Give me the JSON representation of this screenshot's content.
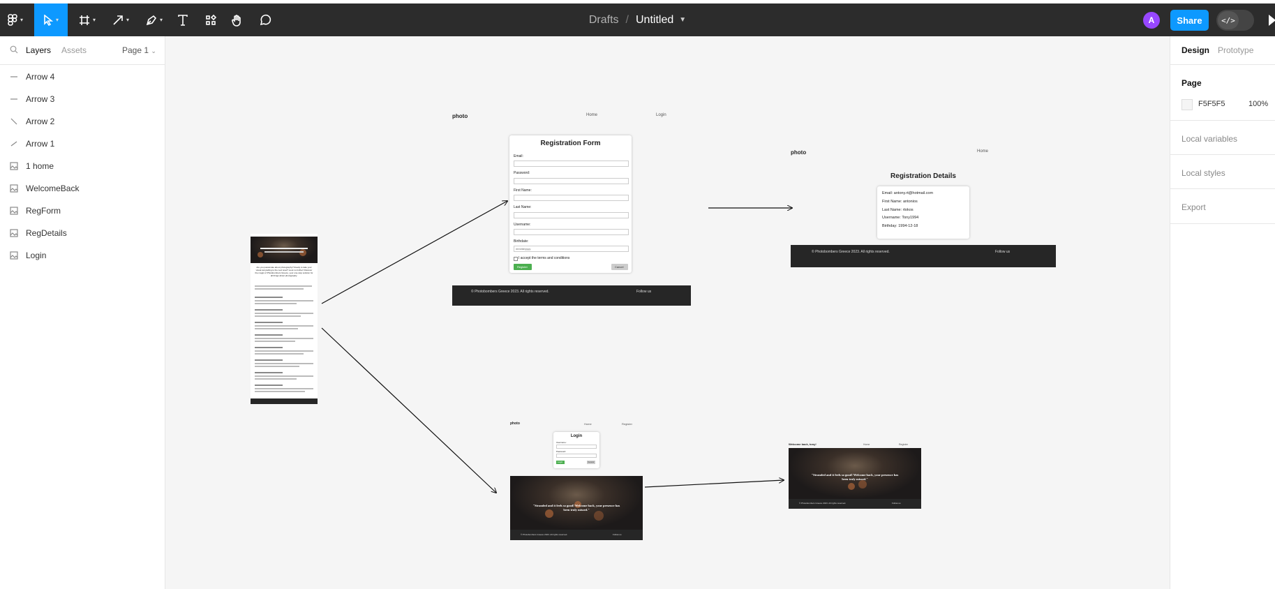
{
  "toolbar": {
    "breadcrumb_drafts": "Drafts",
    "breadcrumb_sep": "/",
    "file_title": "Untitled",
    "avatar_initial": "A",
    "share_label": "Share",
    "dev_mode_icon": "</>",
    "tools": [
      "main-menu",
      "move",
      "frame",
      "shape-arrow",
      "pen",
      "text",
      "resources",
      "hand",
      "comment"
    ]
  },
  "left_panel": {
    "tab_layers": "Layers",
    "tab_assets": "Assets",
    "page_selector": "Page 1",
    "layers": [
      {
        "label": "Arrow 4",
        "icon": "line-horizontal-icon"
      },
      {
        "label": "Arrow 3",
        "icon": "line-horizontal-icon"
      },
      {
        "label": "Arrow 2",
        "icon": "line-diagonal-icon"
      },
      {
        "label": "Arrow 1",
        "icon": "line-slight-icon"
      },
      {
        "label": "1 home",
        "icon": "image-icon"
      },
      {
        "label": "WelcomeBack",
        "icon": "image-icon"
      },
      {
        "label": "RegForm",
        "icon": "image-icon"
      },
      {
        "label": "RegDetails",
        "icon": "image-icon"
      },
      {
        "label": "Login",
        "icon": "image-icon"
      }
    ]
  },
  "right_panel": {
    "tab_design": "Design",
    "tab_prototype": "Prototype",
    "page_section": "Page",
    "page_color_hex": "F5F5F5",
    "page_opacity": "100%",
    "local_variables": "Local variables",
    "local_styles": "Local styles",
    "export": "Export"
  },
  "canvas": {
    "regform": {
      "logo": "photo",
      "nav_home": "Home",
      "nav_login": "Login",
      "title": "Registration Form",
      "fields": [
        "Email:",
        "Password:",
        "First Name:",
        "Last Name:",
        "Username:",
        "Birthdate:"
      ],
      "date_placeholder": "mm/dd/yyyy",
      "terms": "I accept the terms and conditions",
      "register_btn": "Register",
      "cancel_btn": "Cancel",
      "footer_copy": "© Photobombers Greece 2023. All rights reserved.",
      "footer_follow": "Follow us"
    },
    "regdetails": {
      "logo": "photo",
      "nav_home": "Home",
      "title": "Registration Details",
      "lines": [
        "Email: antony.rt@hotmail.com",
        "First Name: antonios",
        "Last Name: rtokos",
        "Username: Tony1994",
        "Birthday: 1994-12-18"
      ],
      "footer_copy": "© Photobombers Greece 2023. All rights reserved.",
      "footer_follow": "Follow us"
    },
    "home": {
      "intro": "Are you passionate about photography? Ready to take your visual storytelling to the next level? Look no further! Discover the magic of Photobombers Greece, your one-stop solution for all things about photography."
    },
    "login": {
      "logo": "photo",
      "nav_home": "Home",
      "nav_register": "Register",
      "title": "Login",
      "username_label": "Username:",
      "password_label": "Password:",
      "login_btn": "Login",
      "cancel_btn": "Cancel",
      "hero_quote": "\"Stranded and it feels so good! Welcome back, your presence has been truly missed.\"",
      "footer_copy": "© Photobombers Greece 2023. All rights reserved.",
      "footer_follow": "Follow us"
    },
    "welcome": {
      "greeting": "Welcome back, tony!",
      "nav_home": "Home",
      "nav_register": "Register",
      "hero_quote": "\"Stranded and it feels so good! Welcome back, your presence has been truly missed.\"",
      "footer_copy": "© Photobombers Greece 2023. All rights reserved.",
      "footer_follow": "Follow us"
    }
  }
}
